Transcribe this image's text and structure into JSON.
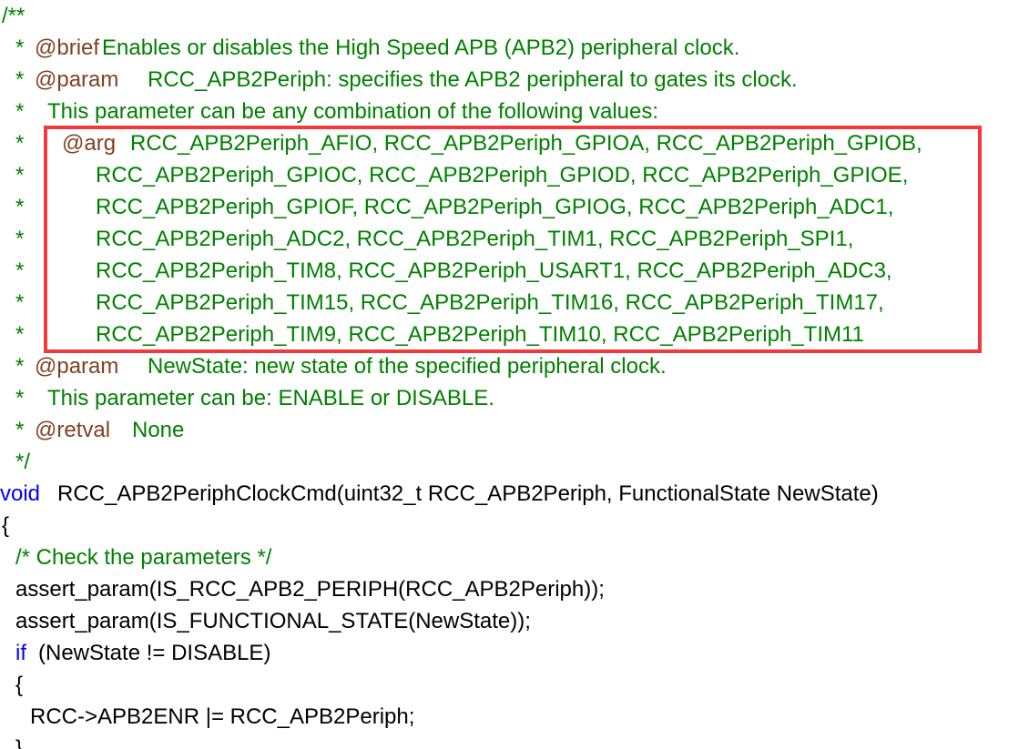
{
  "highlight_color": "#f03a3c",
  "lines": [
    {
      "a": "/**"
    },
    {
      "star": "*",
      "tag": "@brief",
      "text": "Enables or disables the High Speed APB (APB2) peripheral clock."
    },
    {
      "star": "*",
      "tag": "@param",
      "text": "RCC_APB2Periph: specifies the APB2 peripheral to gates its clock."
    },
    {
      "star": "*",
      "text": "This parameter can be any combination of the following values:"
    },
    {
      "star": "*",
      "tag": "@arg",
      "text": "RCC_APB2Periph_AFIO, RCC_APB2Periph_GPIOA, RCC_APB2Periph_GPIOB,"
    },
    {
      "star": "*",
      "text": "RCC_APB2Periph_GPIOC, RCC_APB2Periph_GPIOD, RCC_APB2Periph_GPIOE,"
    },
    {
      "star": "*",
      "text": "RCC_APB2Periph_GPIOF, RCC_APB2Periph_GPIOG, RCC_APB2Periph_ADC1,"
    },
    {
      "star": "*",
      "text": "RCC_APB2Periph_ADC2, RCC_APB2Periph_TIM1, RCC_APB2Periph_SPI1,"
    },
    {
      "star": "*",
      "text": "RCC_APB2Periph_TIM8, RCC_APB2Periph_USART1, RCC_APB2Periph_ADC3,"
    },
    {
      "star": "*",
      "text": "RCC_APB2Periph_TIM15, RCC_APB2Periph_TIM16, RCC_APB2Periph_TIM17,"
    },
    {
      "star": "*",
      "text": "RCC_APB2Periph_TIM9, RCC_APB2Periph_TIM10, RCC_APB2Periph_TIM11"
    },
    {
      "star": "*",
      "tag": "@param",
      "text": "NewState: new state of the specified peripheral clock."
    },
    {
      "star": "*",
      "text": "This parameter can be: ENABLE or DISABLE."
    },
    {
      "star": "*",
      "tag": "@retval",
      "text": "None"
    },
    {
      "a": "*/"
    },
    {
      "kw": "void",
      "text": "RCC_APB2PeriphClockCmd(uint32_t RCC_APB2Periph, FunctionalState NewState)"
    },
    {
      "a": "{"
    },
    {
      "a": "/* Check the parameters */"
    },
    {
      "a": "assert_param(IS_RCC_APB2_PERIPH(RCC_APB2Periph));"
    },
    {
      "a": "assert_param(IS_FUNCTIONAL_STATE(NewState));"
    },
    {
      "kw": "if",
      "text": "(NewState != DISABLE)"
    },
    {
      "a": "{"
    },
    {
      "a": "RCC->APB2ENR |= RCC_APB2Periph;"
    },
    {
      "a": "}"
    }
  ]
}
